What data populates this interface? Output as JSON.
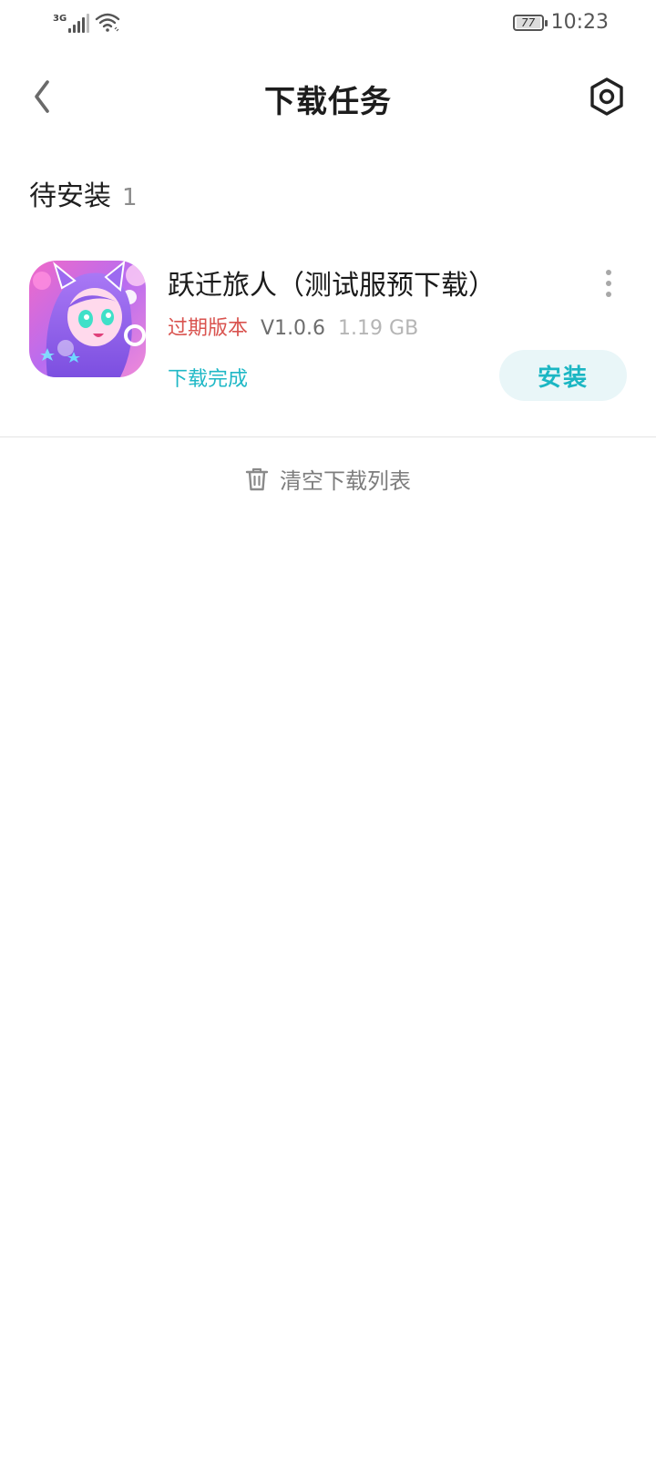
{
  "status_bar": {
    "network_type": "3G",
    "battery_level": "77",
    "time": "10:23",
    "icons": [
      "signal-icon",
      "wifi-icon",
      "battery-icon"
    ]
  },
  "header": {
    "title": "下载任务",
    "back_icon": "chevron-left-icon",
    "settings_icon": "settings-hexagon-icon"
  },
  "section": {
    "title": "待安装",
    "count": "1"
  },
  "downloads": [
    {
      "name": "跃迁旅人（测试服预下载）",
      "tag": "过期版本",
      "version": "V1.0.6",
      "size": "1.19 GB",
      "status": "下载完成",
      "action_label": "安装"
    }
  ],
  "footer": {
    "clear_label": "清空下载列表",
    "clear_icon": "trash-icon"
  },
  "colors": {
    "accent": "#1bb6c3",
    "accent_bg": "#e9f6f8",
    "expired": "#d9534f",
    "muted": "#8c8c8c"
  }
}
